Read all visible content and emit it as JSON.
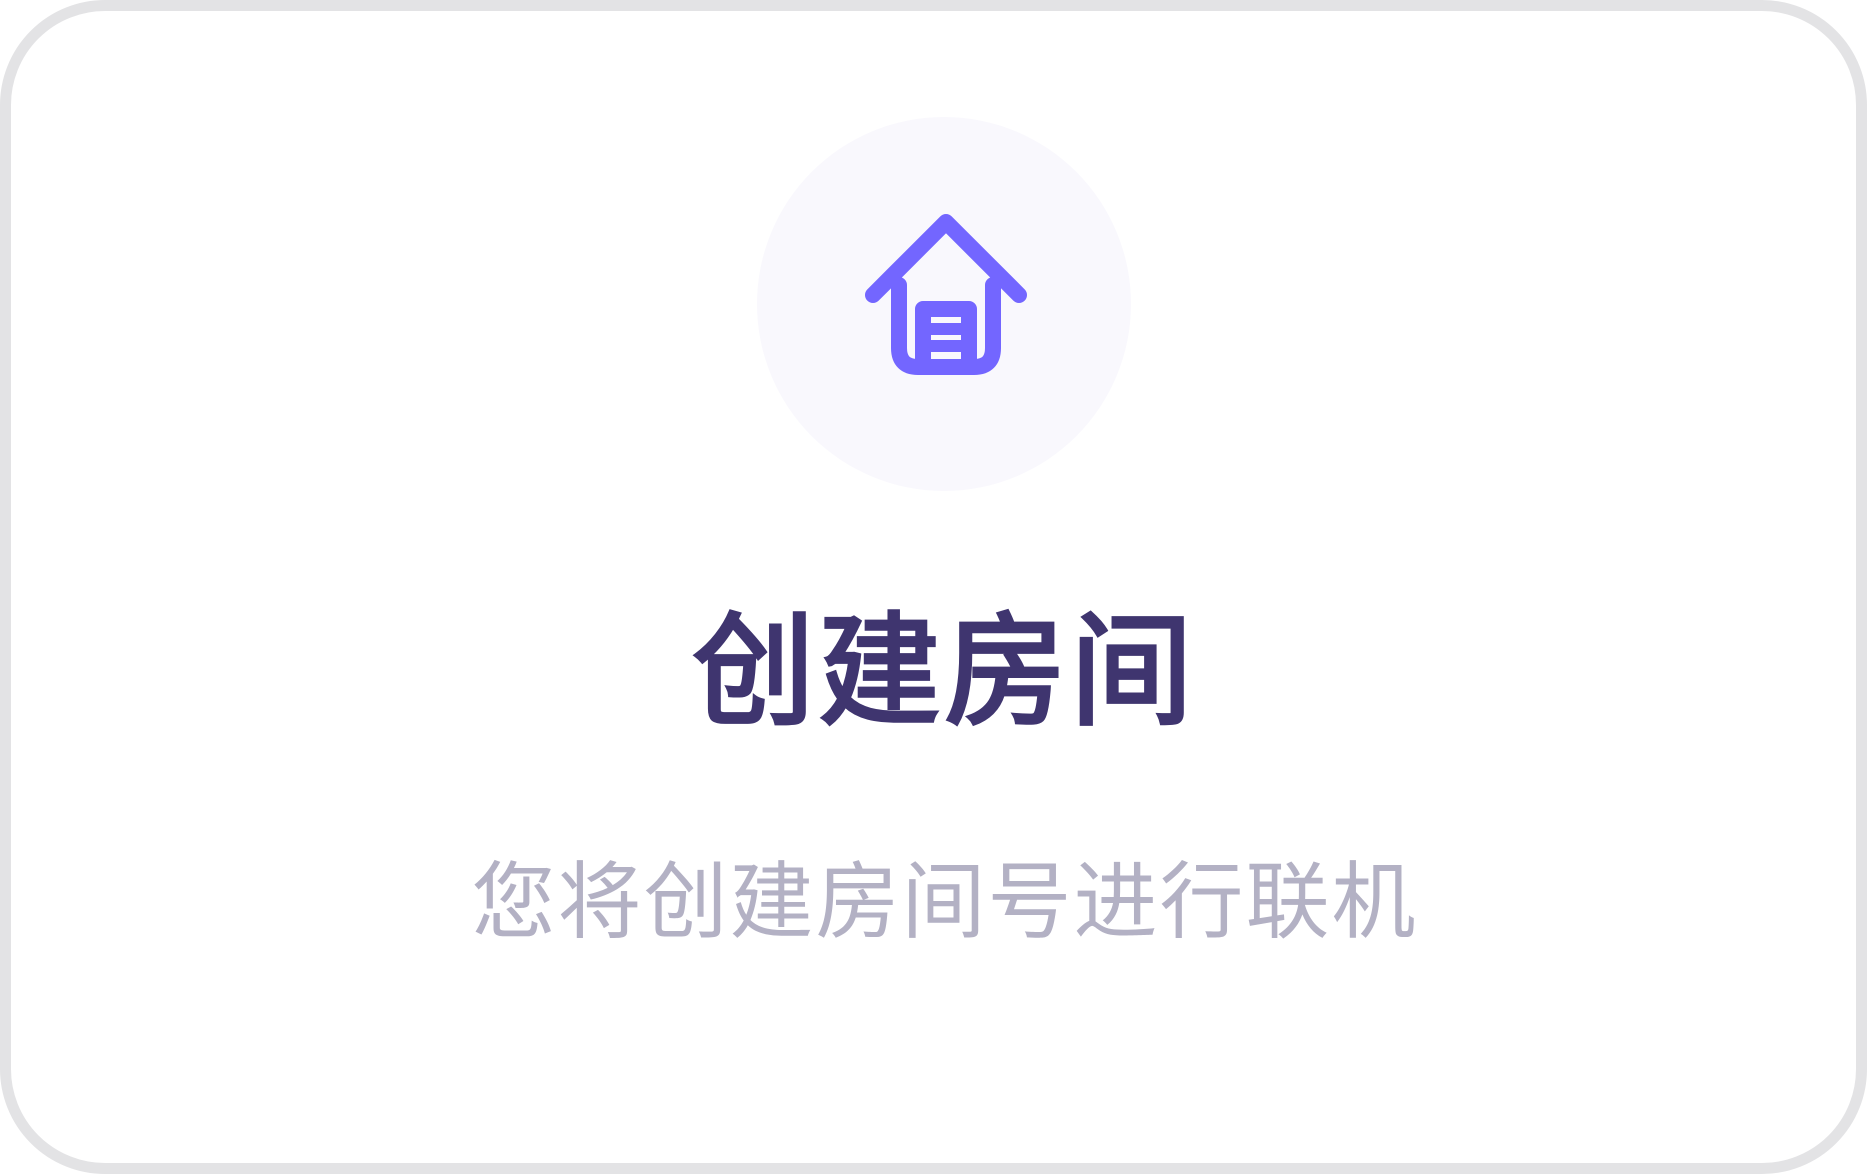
{
  "card": {
    "icon": "house-icon",
    "title": "创建房间",
    "subtitle": "您将创建房间号进行联机"
  },
  "colors": {
    "accent": "#7366ff",
    "title": "#3f356f",
    "subtitle": "#b3b1c4",
    "icon_bg": "#f9f8fd",
    "border": "#e3e3e5"
  }
}
